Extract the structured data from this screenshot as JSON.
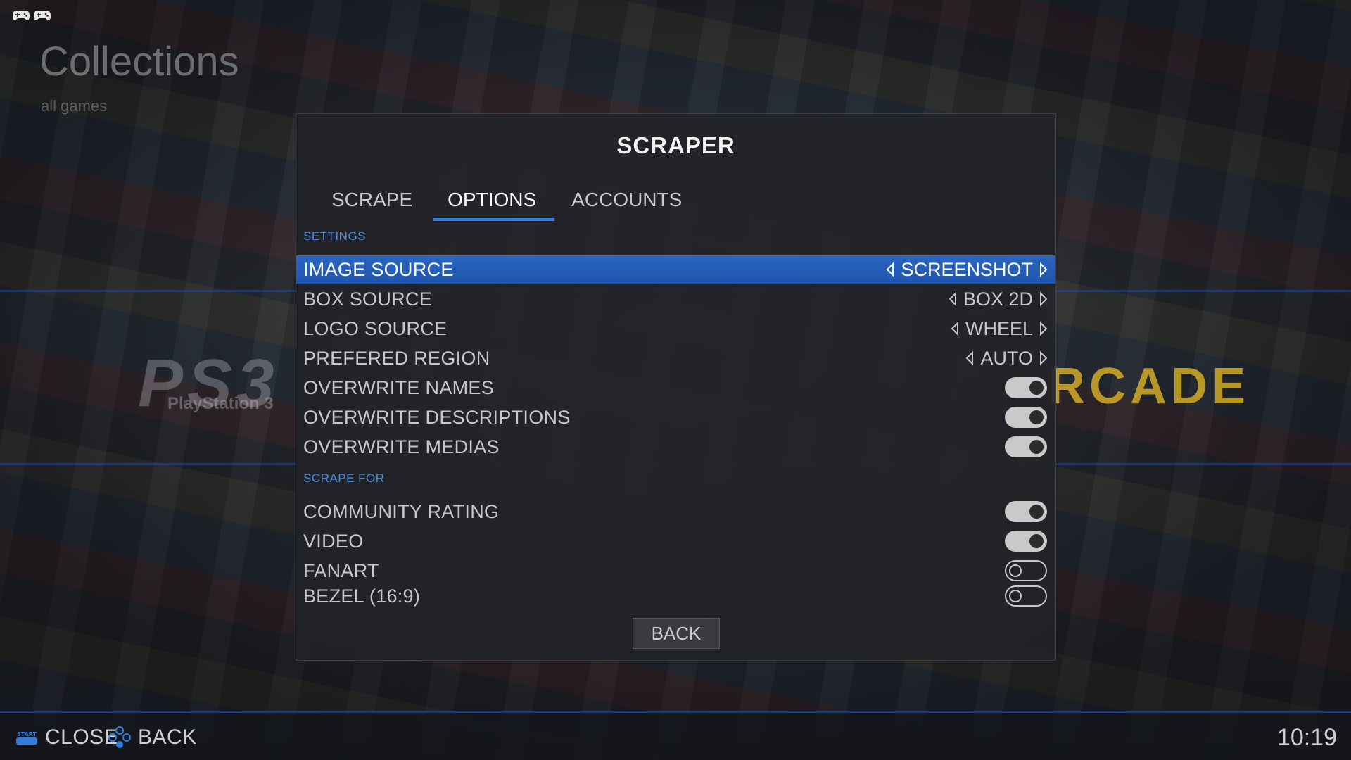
{
  "background": {
    "title": "Collections",
    "subtitle": "all games",
    "system_logo_left": "PS3",
    "system_logo_left_sub": "PlayStation 3",
    "system_logo_right": "RCADE"
  },
  "modal": {
    "title": "SCRAPER",
    "tabs": [
      {
        "label": "SCRAPE",
        "active": false
      },
      {
        "label": "OPTIONS",
        "active": true
      },
      {
        "label": "ACCOUNTS",
        "active": false
      }
    ],
    "sections": {
      "settings": "SETTINGS",
      "scrape_for": "SCRAPE FOR"
    },
    "rows": {
      "image_source": {
        "label": "IMAGE SOURCE",
        "value": "SCREENSHOT",
        "selected": true
      },
      "box_source": {
        "label": "BOX SOURCE",
        "value": "BOX 2D"
      },
      "logo_source": {
        "label": "LOGO SOURCE",
        "value": "WHEEL"
      },
      "prefered_region": {
        "label": "PREFERED REGION",
        "value": "AUTO"
      },
      "overwrite_names": {
        "label": "OVERWRITE NAMES",
        "toggle": "on"
      },
      "overwrite_descriptions": {
        "label": "OVERWRITE DESCRIPTIONS",
        "toggle": "on"
      },
      "overwrite_medias": {
        "label": "OVERWRITE MEDIAS",
        "toggle": "on"
      },
      "community_rating": {
        "label": "COMMUNITY RATING",
        "toggle": "on"
      },
      "video": {
        "label": "VIDEO",
        "toggle": "on"
      },
      "fanart": {
        "label": "FANART",
        "toggle": "off"
      },
      "bezel": {
        "label": "BEZEL (16:9)",
        "toggle": "off"
      }
    },
    "back_button": "BACK"
  },
  "helpbar": {
    "start_badge": "START",
    "close_label": "CLOSE",
    "back_label": "BACK",
    "clock": "10:19"
  },
  "colors": {
    "accent": "#2f7de0",
    "selected_row": "#2463bf",
    "section_header": "#4a8be0",
    "modal_bg": "#222428"
  }
}
